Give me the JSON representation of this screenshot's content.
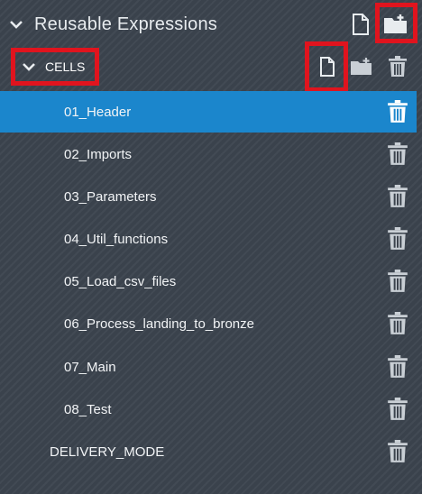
{
  "header": {
    "title": "Reusable Expressions",
    "new_file_icon": "file-icon",
    "new_folder_icon": "folder-plus-icon",
    "collapse_icon": "chevron-down-icon"
  },
  "group": {
    "label": "CELLS",
    "collapse_icon": "chevron-down-icon",
    "new_file_icon": "file-icon",
    "new_folder_icon": "folder-plus-icon",
    "delete_icon": "trash-icon"
  },
  "items": [
    {
      "label": "01_Header",
      "selected": true
    },
    {
      "label": "02_Imports"
    },
    {
      "label": "03_Parameters"
    },
    {
      "label": "04_Util_functions"
    },
    {
      "label": "05_Load_csv_files"
    },
    {
      "label": "06_Process_landing_to_bronze"
    },
    {
      "label": "07_Main"
    },
    {
      "label": "08_Test"
    }
  ],
  "toplevel_item": {
    "label": "DELIVERY_MODE"
  },
  "colors": {
    "selected": "#1b86cc",
    "highlight": "#e0141e",
    "background": "#3a424c"
  }
}
